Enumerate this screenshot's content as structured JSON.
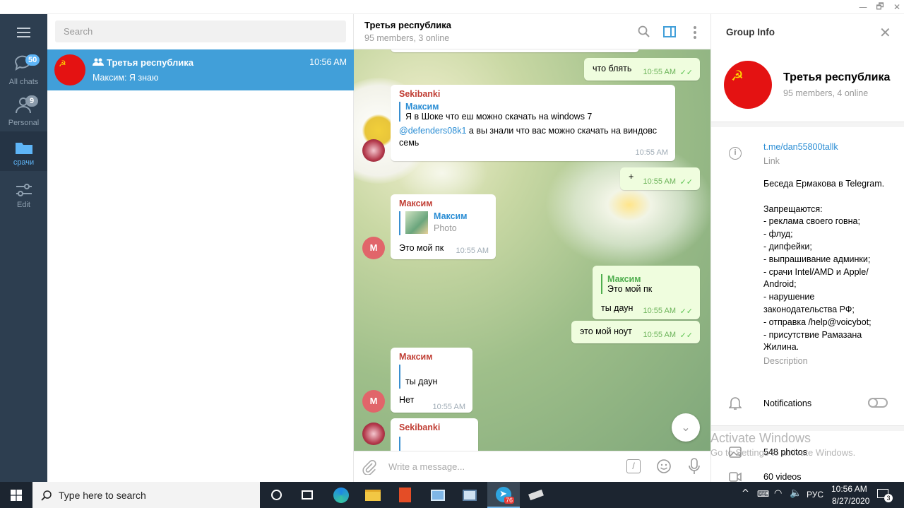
{
  "window": {
    "minimize": "—",
    "restore": "🗗",
    "close": "✕"
  },
  "nav": {
    "items": [
      {
        "label": "All chats",
        "badge": "50"
      },
      {
        "label": "Personal",
        "badge": "9"
      },
      {
        "label": "срачи",
        "badge": ""
      },
      {
        "label": "Edit",
        "badge": ""
      }
    ]
  },
  "chatlist": {
    "search_placeholder": "Search",
    "chats": [
      {
        "name": "Третья республика",
        "time": "10:56 AM",
        "preview": "Максим: Я знаю"
      }
    ]
  },
  "chat": {
    "title": "Третья республика",
    "subtitle": "95 members, 3 online",
    "composer_placeholder": "Write a message...",
    "messages": [
      {
        "text": "что блять",
        "time": "10:55 AM"
      },
      {
        "sender": "Sekibanki",
        "reply_name": "Максим",
        "reply_text": "Я в Шоке что еш можно скачать на windows 7",
        "mention": "@defenders08k1",
        "text": " а вы знали что вас можно скачать на виндовс семь",
        "time": "10:55 AM"
      },
      {
        "text": "+",
        "time": "10:55 AM"
      },
      {
        "sender": "Максим",
        "reply_name": "Максим",
        "reply_text": "Photo",
        "text": "Это мой пк",
        "time": "10:55 AM",
        "avatar": "M"
      },
      {
        "reply_name": "Максим",
        "reply_text": "Это мой пк",
        "text": "ты даун",
        "time": "10:55 AM"
      },
      {
        "text": "это мой ноут",
        "time": "10:55 AM"
      },
      {
        "sender": "Максим",
        "reply_text": "ты даун",
        "text": "Нет",
        "time": "10:55 AM",
        "avatar": "M"
      },
      {
        "sender": "Sekibanki"
      }
    ]
  },
  "info": {
    "header": "Group Info",
    "name": "Третья республика",
    "status": "95 members, 4 online",
    "link": "t.me/dan55800tallk",
    "link_label": "Link",
    "description_lines": [
      "Беседа Ермакова в Telegram.",
      "",
      "Запрещаются:",
      "- реклама своего говна;",
      "- флуд;",
      "- дипфейки;",
      "- выпрашивание админки;",
      "- срачи Intel/AMD и Apple/",
      "Android;",
      "- нарушение",
      "законодательства РФ;",
      "- отправка /help@voicybot;",
      "- присутствие Рамазана",
      "Жилина."
    ],
    "description_label": "Description",
    "notifications": "Notifications",
    "photos": "548 photos",
    "videos": "60 videos"
  },
  "watermark": {
    "line1": "Activate Windows",
    "line2": "Go to Settings to activate Windows."
  },
  "taskbar": {
    "search": "Type here to search",
    "lang": "РУС",
    "time": "10:56 AM",
    "date": "8/27/2020",
    "tg_badge": "76",
    "notif": "3"
  },
  "colors": {
    "accent": "#419fd9",
    "sidebar": "#2d3e50",
    "out_bubble": "#effdde",
    "taskbar": "#1c2530"
  }
}
